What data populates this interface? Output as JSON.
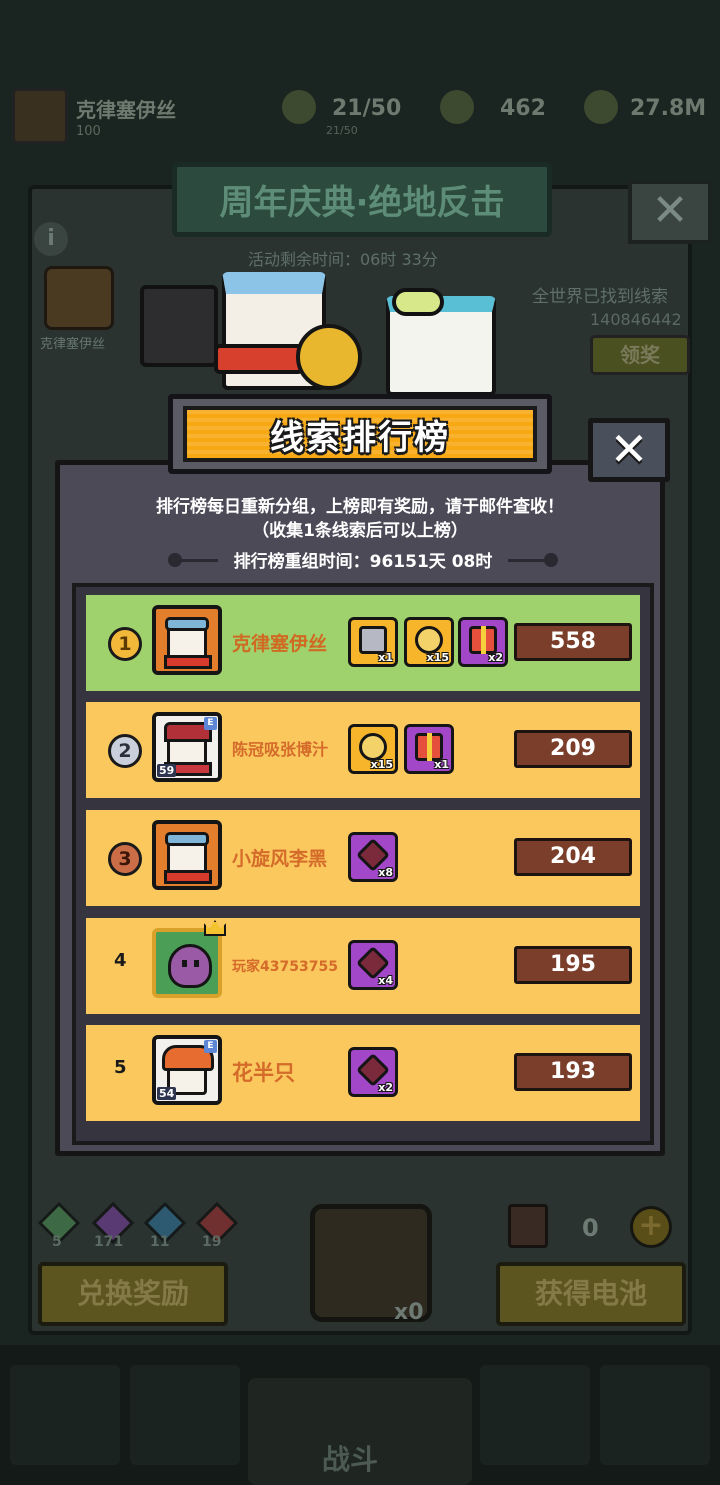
{
  "background": {
    "player_name": "克律塞伊丝",
    "player_level": "100",
    "energy": "21/50",
    "energy_sub": "21/50",
    "gems_stat": "462",
    "coins_stat": "27.8M",
    "event_title": "周年庆典·绝地反击",
    "event_timer": "活动剩余时间：06时 33分",
    "left_avatar_name": "克律塞伊丝",
    "world_found_label": "全世界已找到线索",
    "world_found_count": "140846442",
    "claim_button": "领奖",
    "gem_counts": [
      {
        "value": "5",
        "color": "#3d6a44"
      },
      {
        "value": "171",
        "color": "#5a3a72"
      },
      {
        "value": "11",
        "color": "#2d5a70"
      },
      {
        "value": "19",
        "color": "#703030"
      }
    ],
    "exchange_button": "兑换奖励",
    "get_battery_button": "获得电池",
    "lock_count": "x0",
    "battery_count": "0",
    "battle_label": "战斗"
  },
  "leaderboard": {
    "title": "线索排行榜",
    "close_label": "✕",
    "description_line1": "排行榜每日重新分组，上榜即有奖励，请于邮件查收！",
    "description_line2": "（收集1条线索后可以上榜）",
    "reset_label": "排行榜重组时间：96151天 08时",
    "rows": [
      {
        "rank": "1",
        "medal": "gold",
        "name": "克律塞伊丝",
        "score": "558",
        "level": "",
        "badge": "",
        "rewards": [
          {
            "kind": "crate",
            "qty": "x1"
          },
          {
            "kind": "coin",
            "qty": "x15"
          },
          {
            "kind": "gift",
            "qty": "x2"
          }
        ]
      },
      {
        "rank": "2",
        "medal": "silver",
        "name": "陈冠吸张博汁",
        "score": "209",
        "level": "59",
        "badge": "E",
        "rewards": [
          {
            "kind": "coin",
            "qty": "x15"
          },
          {
            "kind": "gift",
            "qty": "x1"
          }
        ]
      },
      {
        "rank": "3",
        "medal": "bronze",
        "name": "小旋风李黑",
        "score": "204",
        "level": "",
        "badge": "",
        "rewards": [
          {
            "kind": "piece",
            "qty": "x8"
          }
        ]
      },
      {
        "rank": "4",
        "medal": "",
        "name": "玩家43753755",
        "score": "195",
        "level": "",
        "badge": "",
        "rewards": [
          {
            "kind": "piece",
            "qty": "x4"
          }
        ]
      },
      {
        "rank": "5",
        "medal": "",
        "name": "花半只",
        "score": "193",
        "level": "54",
        "badge": "E",
        "rewards": [
          {
            "kind": "piece",
            "qty": "x2"
          }
        ]
      }
    ]
  }
}
